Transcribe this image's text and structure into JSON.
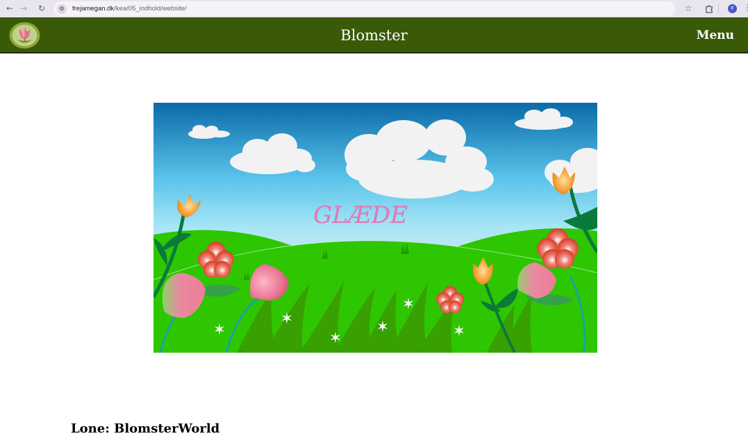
{
  "browser": {
    "url_host": "frejamegan.dk",
    "url_path": "/kea/05_indhold/website/",
    "profile_initial": "F",
    "icons": {
      "back": "arrow-left-icon",
      "forward": "arrow-right-icon",
      "reload": "reload-icon",
      "site_info": "site-settings-icon",
      "bookmark": "star-icon",
      "extensions": "puzzle-icon",
      "menu": "kebab-menu-icon"
    }
  },
  "header": {
    "title": "Blomster",
    "menu_label": "Menu",
    "background_color": "#3a5a08",
    "logo_icon": "tulip-logo-icon"
  },
  "hero": {
    "text": "GLÆDE"
  },
  "content": {
    "heading": "Lone: BlomsterWorld"
  }
}
